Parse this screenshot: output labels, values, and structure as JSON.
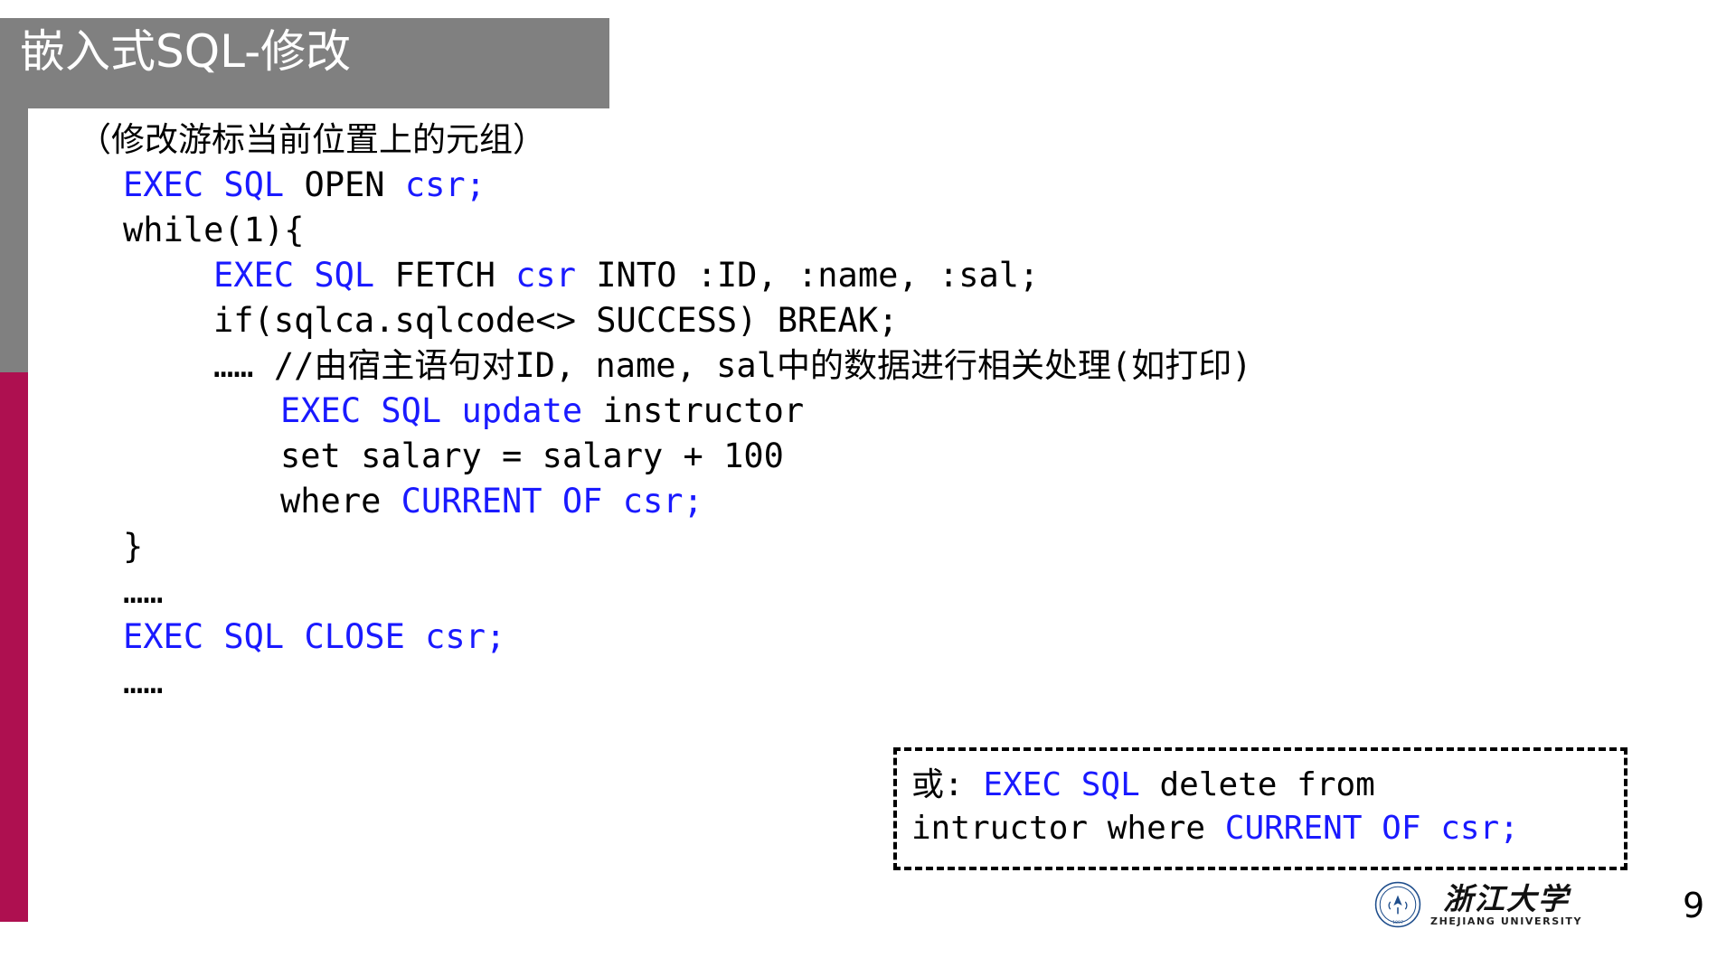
{
  "slide": {
    "title": "嵌入式SQL-修改",
    "page_number": "9"
  },
  "colors": {
    "title_bar": "#808080",
    "accent_bar": "#ae1050",
    "keyword": "#1a1aff",
    "text": "#000000",
    "background": "#ffffff"
  },
  "body": {
    "subtitle": "（修改游标当前位置上的元组）",
    "lines": [
      {
        "id": "open",
        "indent": 1,
        "parts": [
          {
            "t": "EXEC SQL ",
            "c": "kw"
          },
          {
            "t": "OPEN ",
            "c": "bk"
          },
          {
            "t": "csr;",
            "c": "kw"
          }
        ]
      },
      {
        "id": "while",
        "indent": 1,
        "parts": [
          {
            "t": "while(1){",
            "c": "bk"
          }
        ]
      },
      {
        "id": "fetch",
        "indent": 2,
        "parts": [
          {
            "t": "EXEC SQL ",
            "c": "kw"
          },
          {
            "t": "FETCH ",
            "c": "bk"
          },
          {
            "t": "csr ",
            "c": "kw"
          },
          {
            "t": "INTO :ID, :name, :sal;",
            "c": "bk"
          }
        ]
      },
      {
        "id": "if",
        "indent": 2,
        "parts": [
          {
            "t": "if(sqlca.sqlcode<> SUCCESS) BREAK;",
            "c": "bk"
          }
        ]
      },
      {
        "id": "comment",
        "indent": 2,
        "parts": [
          {
            "t": "…… //由宿主语句对ID, name, sal中的数据进行相关处理(如打印)",
            "c": "bk"
          }
        ]
      },
      {
        "id": "update",
        "indent": 3,
        "parts": [
          {
            "t": "EXEC SQL update ",
            "c": "kw"
          },
          {
            "t": "instructor",
            "c": "bk"
          }
        ]
      },
      {
        "id": "set",
        "indent": 3,
        "parts": [
          {
            "t": "set salary = salary + 100",
            "c": "bk"
          }
        ]
      },
      {
        "id": "where",
        "indent": 3,
        "parts": [
          {
            "t": "where ",
            "c": "bk"
          },
          {
            "t": "CURRENT OF csr;",
            "c": "kw"
          }
        ]
      },
      {
        "id": "brace",
        "indent": 1,
        "parts": [
          {
            "t": "}",
            "c": "bk"
          }
        ]
      },
      {
        "id": "dots1",
        "indent": 1,
        "parts": [
          {
            "t": "……",
            "c": "bk"
          }
        ]
      },
      {
        "id": "close",
        "indent": 1,
        "parts": [
          {
            "t": "EXEC SQL CLOSE csr;",
            "c": "kw"
          }
        ]
      },
      {
        "id": "dots2",
        "indent": 1,
        "parts": [
          {
            "t": "……",
            "c": "bk"
          }
        ]
      }
    ]
  },
  "note_box": {
    "lines": [
      {
        "id": "note1",
        "parts": [
          {
            "t": "或: ",
            "c": "bk"
          },
          {
            "t": "EXEC SQL ",
            "c": "kw"
          },
          {
            "t": "delete from",
            "c": "bk"
          }
        ]
      },
      {
        "id": "note2",
        "parts": [
          {
            "t": "intructor where ",
            "c": "bk"
          },
          {
            "t": "CURRENT OF csr;",
            "c": "kw"
          }
        ]
      }
    ]
  },
  "footer": {
    "logo_cn": "浙江大学",
    "logo_en": "ZHEJIANG UNIVERSITY"
  }
}
